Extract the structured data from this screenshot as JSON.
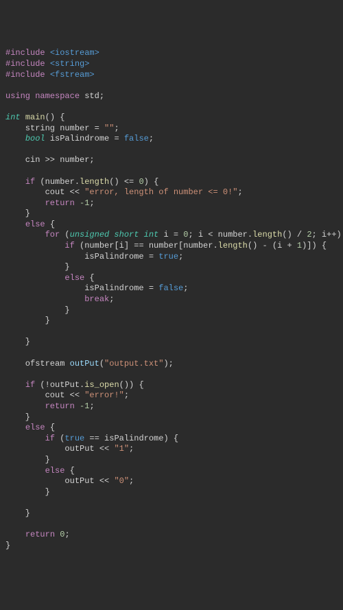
{
  "code": {
    "l1a": "#include ",
    "l1b": "<iostream>",
    "l2a": "#include ",
    "l2b": "<string>",
    "l3a": "#include ",
    "l3b": "<fstream>",
    "l5a": "using ",
    "l5b": "namespace ",
    "l5c": "std;",
    "l7a": "int ",
    "l7b": "main",
    "l7c": "() {",
    "l8a": "    string number = ",
    "l8b": "\"\"",
    "l8c": ";",
    "l9a": "    ",
    "l9b": "bool",
    "l9c": " isPalindrome = ",
    "l9d": "false",
    "l9e": ";",
    "l11": "    cin >> number;",
    "l13a": "    ",
    "l13b": "if",
    "l13c": " (number.",
    "l13d": "length",
    "l13e": "() <= ",
    "l13f": "0",
    "l13g": ") {",
    "l14a": "        cout << ",
    "l14b": "\"error, length of number <= 0!\"",
    "l14c": ";",
    "l15a": "        ",
    "l15b": "return ",
    "l15c": "-1",
    "l15d": ";",
    "l16": "    }",
    "l17a": "    ",
    "l17b": "else",
    "l17c": " {",
    "l18a": "        ",
    "l18b": "for",
    "l18c": " (",
    "l18d": "unsigned short int",
    "l18e": " i = ",
    "l18f": "0",
    "l18g": "; i < number.",
    "l18h": "length",
    "l18i": "() / ",
    "l18j": "2",
    "l18k": "; i++) {",
    "l19a": "            ",
    "l19b": "if",
    "l19c": " (number[i] == number[number.",
    "l19d": "length",
    "l19e": "() - (i + ",
    "l19f": "1",
    "l19g": ")]) {",
    "l20a": "                isPalindrome = ",
    "l20b": "true",
    "l20c": ";",
    "l21": "            }",
    "l22a": "            ",
    "l22b": "else",
    "l22c": " {",
    "l23a": "                isPalindrome = ",
    "l23b": "false",
    "l23c": ";",
    "l24a": "                ",
    "l24b": "break",
    "l24c": ";",
    "l25": "            }",
    "l26": "        }",
    "l28": "    }",
    "l30a": "    ofstream ",
    "l30b": "outPut",
    "l30c": "(",
    "l30d": "\"output.txt\"",
    "l30e": ");",
    "l32a": "    ",
    "l32b": "if",
    "l32c": " (!outPut.",
    "l32d": "is_open",
    "l32e": "()) {",
    "l33a": "        cout << ",
    "l33b": "\"error!\"",
    "l33c": ";",
    "l34a": "        ",
    "l34b": "return ",
    "l34c": "-1",
    "l34d": ";",
    "l35": "    }",
    "l36a": "    ",
    "l36b": "else",
    "l36c": " {",
    "l37a": "        ",
    "l37b": "if",
    "l37c": " (",
    "l37d": "true",
    "l37e": " == isPalindrome) {",
    "l38a": "            outPut << ",
    "l38b": "\"1\"",
    "l38c": ";",
    "l39": "        }",
    "l40a": "        ",
    "l40b": "else",
    "l40c": " {",
    "l41a": "            outPut << ",
    "l41b": "\"0\"",
    "l41c": ";",
    "l42": "        }",
    "l44": "    }",
    "l46a": "    ",
    "l46b": "return ",
    "l46c": "0",
    "l46d": ";",
    "l47": "}"
  }
}
